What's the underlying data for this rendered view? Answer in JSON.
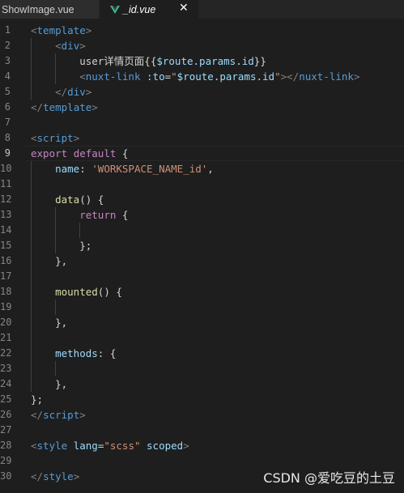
{
  "tabs": [
    {
      "label": "ShowImage.vue",
      "active": false
    },
    {
      "label": "_id.vue",
      "active": true,
      "icon": "vue-icon",
      "close": "✕"
    }
  ],
  "editor": {
    "current_line": 9,
    "lines": [
      {
        "n": "1",
        "tokens": [
          [
            "t-punc",
            "<"
          ],
          [
            "t-tag",
            "template"
          ],
          [
            "t-punc",
            ">"
          ]
        ]
      },
      {
        "n": "2",
        "tokens": [
          [
            "t-txt",
            "    "
          ],
          [
            "t-punc",
            "<"
          ],
          [
            "t-tag",
            "div"
          ],
          [
            "t-punc",
            ">"
          ]
        ]
      },
      {
        "n": "3",
        "tokens": [
          [
            "t-txt",
            "        user详情页面{{"
          ],
          [
            "t-var",
            "$route"
          ],
          [
            "t-txt",
            "."
          ],
          [
            "t-var",
            "params"
          ],
          [
            "t-txt",
            "."
          ],
          [
            "t-var",
            "id"
          ],
          [
            "t-txt",
            "}}"
          ]
        ]
      },
      {
        "n": "4",
        "tokens": [
          [
            "t-txt",
            "        "
          ],
          [
            "t-punc",
            "<"
          ],
          [
            "t-tag",
            "nuxt-link"
          ],
          [
            "t-txt",
            " "
          ],
          [
            "t-attr",
            ":to"
          ],
          [
            "t-txt",
            "="
          ],
          [
            "t-str",
            "\""
          ],
          [
            "t-var",
            "$route"
          ],
          [
            "t-txt",
            "."
          ],
          [
            "t-var",
            "params"
          ],
          [
            "t-txt",
            "."
          ],
          [
            "t-var",
            "id"
          ],
          [
            "t-str",
            "\""
          ],
          [
            "t-punc",
            "></"
          ],
          [
            "t-tag",
            "nuxt-link"
          ],
          [
            "t-punc",
            ">"
          ]
        ]
      },
      {
        "n": "5",
        "tokens": [
          [
            "t-txt",
            "    "
          ],
          [
            "t-punc",
            "</"
          ],
          [
            "t-tag",
            "div"
          ],
          [
            "t-punc",
            ">"
          ]
        ]
      },
      {
        "n": "6",
        "tokens": [
          [
            "t-punc",
            "</"
          ],
          [
            "t-tag",
            "template"
          ],
          [
            "t-punc",
            ">"
          ]
        ]
      },
      {
        "n": "7",
        "tokens": []
      },
      {
        "n": "8",
        "tokens": [
          [
            "t-punc",
            "<"
          ],
          [
            "t-tag",
            "script"
          ],
          [
            "t-punc",
            ">"
          ]
        ]
      },
      {
        "n": "9",
        "tokens": [
          [
            "t-ctrl",
            "export"
          ],
          [
            "t-txt",
            " "
          ],
          [
            "t-ctrl",
            "default"
          ],
          [
            "t-txt",
            " "
          ],
          [
            "t-txt",
            "{"
          ]
        ]
      },
      {
        "n": "10",
        "tokens": [
          [
            "t-txt",
            "    "
          ],
          [
            "t-attr",
            "name"
          ],
          [
            "t-txt",
            ": "
          ],
          [
            "t-str",
            "'WORKSPACE_NAME_id'"
          ],
          [
            "t-txt",
            ","
          ]
        ]
      },
      {
        "n": "11",
        "tokens": []
      },
      {
        "n": "12",
        "tokens": [
          [
            "t-txt",
            "    "
          ],
          [
            "t-fn",
            "data"
          ],
          [
            "t-txt",
            "() {"
          ]
        ]
      },
      {
        "n": "13",
        "tokens": [
          [
            "t-txt",
            "        "
          ],
          [
            "t-ctrl",
            "return"
          ],
          [
            "t-txt",
            " {"
          ]
        ]
      },
      {
        "n": "14",
        "tokens": []
      },
      {
        "n": "15",
        "tokens": [
          [
            "t-txt",
            "        };"
          ]
        ]
      },
      {
        "n": "16",
        "tokens": [
          [
            "t-txt",
            "    },"
          ]
        ]
      },
      {
        "n": "17",
        "tokens": []
      },
      {
        "n": "18",
        "tokens": [
          [
            "t-txt",
            "    "
          ],
          [
            "t-fn",
            "mounted"
          ],
          [
            "t-txt",
            "() {"
          ]
        ]
      },
      {
        "n": "19",
        "tokens": []
      },
      {
        "n": "20",
        "tokens": [
          [
            "t-txt",
            "    },"
          ]
        ]
      },
      {
        "n": "21",
        "tokens": []
      },
      {
        "n": "22",
        "tokens": [
          [
            "t-txt",
            "    "
          ],
          [
            "t-attr",
            "methods"
          ],
          [
            "t-txt",
            ": {"
          ]
        ]
      },
      {
        "n": "23",
        "tokens": []
      },
      {
        "n": "24",
        "tokens": [
          [
            "t-txt",
            "    },"
          ]
        ]
      },
      {
        "n": "25",
        "tokens": [
          [
            "t-txt",
            "};"
          ]
        ]
      },
      {
        "n": "26",
        "tokens": [
          [
            "t-punc",
            "</"
          ],
          [
            "t-tag",
            "script"
          ],
          [
            "t-punc",
            ">"
          ]
        ]
      },
      {
        "n": "27",
        "tokens": []
      },
      {
        "n": "28",
        "tokens": [
          [
            "t-punc",
            "<"
          ],
          [
            "t-tag",
            "style"
          ],
          [
            "t-txt",
            " "
          ],
          [
            "t-attr",
            "lang"
          ],
          [
            "t-txt",
            "="
          ],
          [
            "t-str",
            "\"scss\""
          ],
          [
            "t-txt",
            " "
          ],
          [
            "t-attr",
            "scoped"
          ],
          [
            "t-punc",
            ">"
          ]
        ]
      },
      {
        "n": "29",
        "tokens": []
      },
      {
        "n": "30",
        "tokens": [
          [
            "t-punc",
            "</"
          ],
          [
            "t-tag",
            "style"
          ],
          [
            "t-punc",
            ">"
          ]
        ]
      }
    ]
  },
  "watermark": "CSDN @爱吃豆的土豆",
  "colors": {
    "background": "#1e1e1e",
    "tag": "#569cd6",
    "string": "#ce9178",
    "attr": "#9cdcfe",
    "keyword_ctrl": "#c586c0",
    "function": "#dcdcaa",
    "vue_green": "#41b883"
  }
}
